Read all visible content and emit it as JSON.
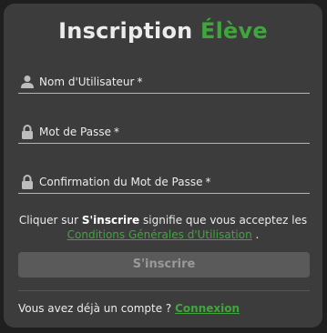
{
  "title": {
    "part1": "Inscription",
    "part2": "Élève"
  },
  "fields": [
    {
      "label": "Nom d'Utilisateur",
      "required": "*",
      "icon": "user-icon"
    },
    {
      "label": "Mot de Passe",
      "required": "*",
      "icon": "lock-icon"
    },
    {
      "label": "Confirmation du Mot de Passe",
      "required": "*",
      "icon": "lock-icon"
    }
  ],
  "terms": {
    "prefix": "Cliquer sur",
    "action": "S'inscrire",
    "suffix": "signifie que vous acceptez les",
    "link": "Conditions Générales d'Utilisation",
    "end": "."
  },
  "submit_label": "S'inscrire",
  "account": {
    "question": "Vous avez déjà un compte ?",
    "link": "Connexion"
  },
  "colors": {
    "accent": "#3fa63c",
    "card": "#3c3c3c",
    "background": "#1f1f1f"
  }
}
